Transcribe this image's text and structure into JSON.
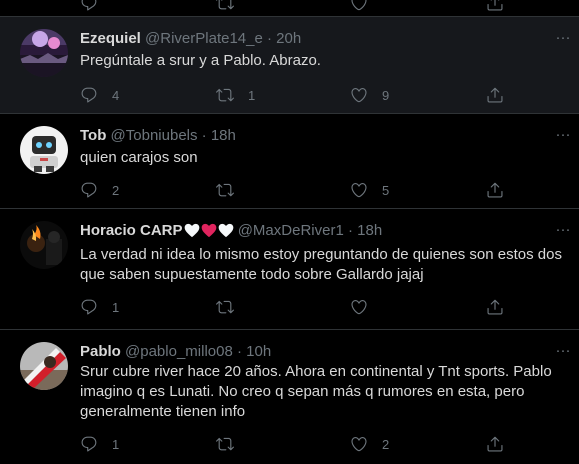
{
  "tweets": [
    {
      "name": "Ezequiel",
      "handle": "@RiverPlate14_e",
      "separator": "·",
      "time": "20h",
      "text": [
        "Pregúntale a srur y a Pablo. Abrazo."
      ],
      "replies": "4",
      "retweets": "1",
      "likes": "9"
    },
    {
      "name": "Tob",
      "handle": "@Tobniubels",
      "separator": "·",
      "time": "18h",
      "text": [
        "quien carajos son"
      ],
      "replies": "2",
      "retweets": "",
      "likes": "5"
    },
    {
      "name": "Horacio CARP",
      "handle": "@MaxDeRiver1",
      "separator": "·",
      "time": "18h",
      "text": [
        "La verdad ni idea lo mismo estoy preguntando de quienes son estos dos",
        "que saben supuestamente todo sobre Gallardo jajaj"
      ],
      "replies": "1",
      "retweets": "",
      "likes": ""
    },
    {
      "name": "Pablo",
      "handle": "@pablo_millo08",
      "separator": "·",
      "time": "10h",
      "text": [
        "Srur cubre river hace 20 años. Ahora en continental y Tnt sports. Pablo",
        "imagino q es Lunati. No creo q sepan más q rumores en esta, pero",
        "generalmente tienen info"
      ],
      "replies": "1",
      "retweets": "",
      "likes": "2"
    }
  ],
  "more_glyph": "···",
  "colors": {
    "background": "#000000",
    "highlight_row": "#16181c",
    "text": "#d9d9d9",
    "muted": "#6e767d",
    "divider": "#2f3336",
    "heart_white": "#f5f8fa",
    "heart_red": "#e0245e"
  }
}
